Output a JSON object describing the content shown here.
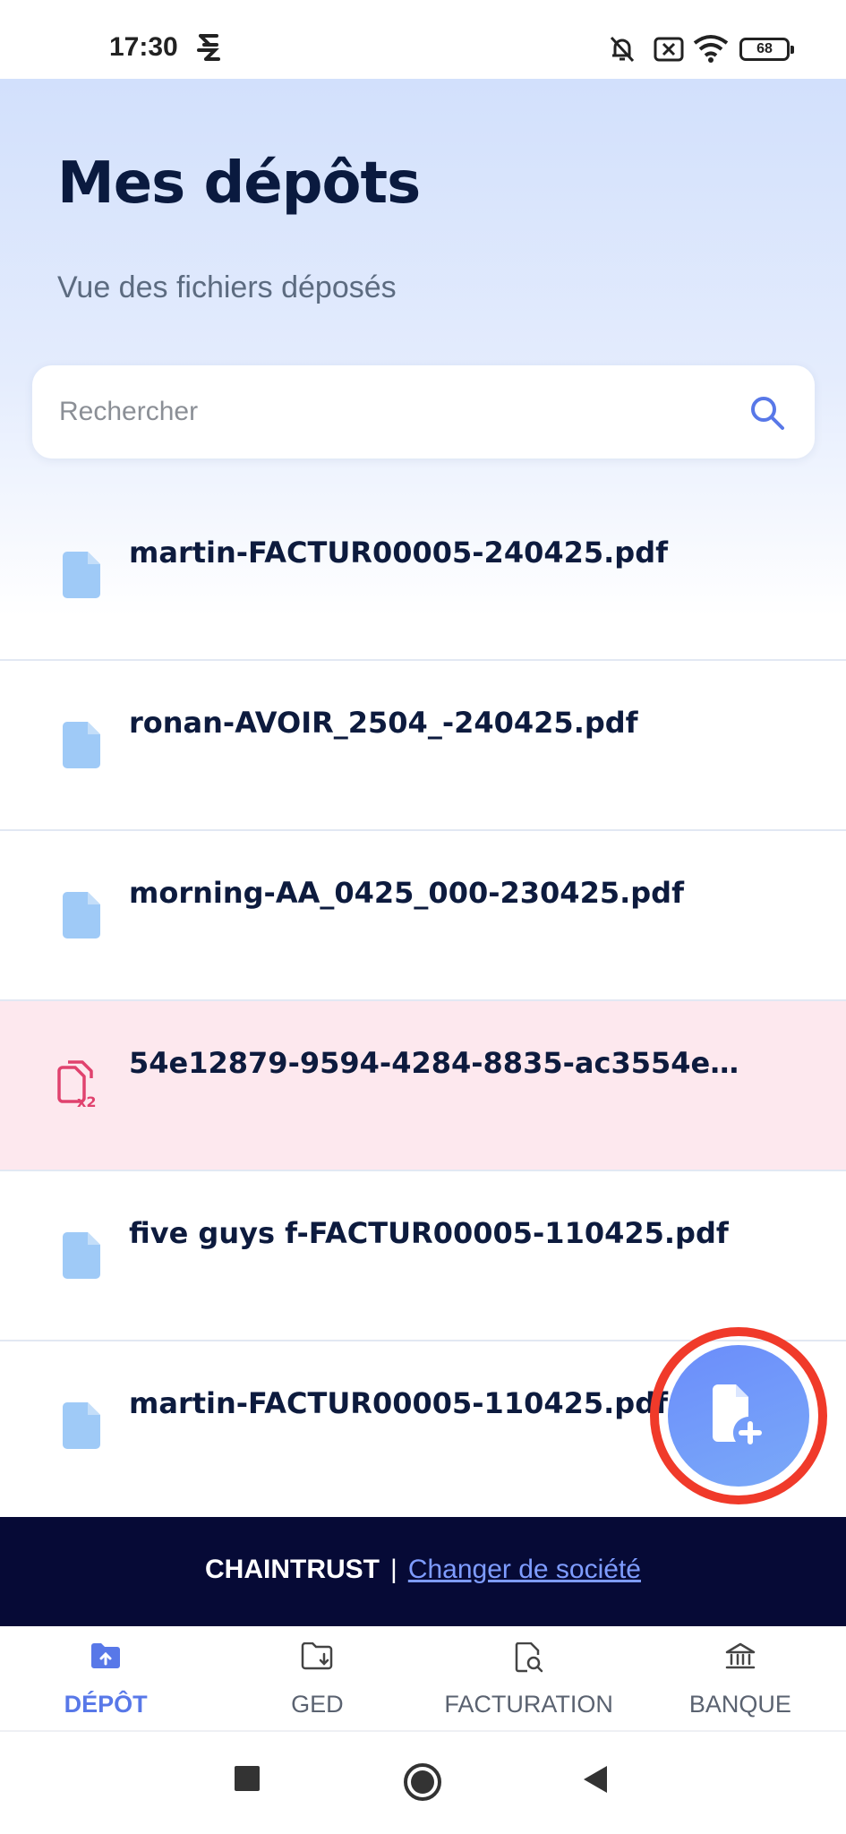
{
  "status_bar": {
    "time": "17:30",
    "battery": "68",
    "icons": [
      "signal-glyph-icon",
      "bell-muted-icon",
      "sim-x-icon",
      "wifi-icon",
      "battery-icon"
    ]
  },
  "header": {
    "title": "Mes dépôts",
    "subtitle": "Vue des fichiers déposés"
  },
  "search": {
    "placeholder": "Rechercher",
    "icon": "search-icon"
  },
  "files": [
    {
      "name": "martin-FACTUR00005-240425.pdf",
      "status": "ok",
      "icon": "file-icon"
    },
    {
      "name": "ronan-AVOIR_2504_-240425.pdf",
      "status": "ok",
      "icon": "file-icon"
    },
    {
      "name": "morning-AA_0425_000-230425.pdf",
      "status": "ok",
      "icon": "file-icon"
    },
    {
      "name": "54e12879-9594-4284-8835-ac3554e…",
      "status": "duplicate",
      "icon": "duplicate-file-icon"
    },
    {
      "name": "five guys f-FACTUR00005-110425.pdf",
      "status": "ok",
      "icon": "file-icon"
    },
    {
      "name": "martin-FACTUR00005-110425.pdf",
      "status": "ok",
      "icon": "file-icon"
    }
  ],
  "fab": {
    "icon": "add-file-icon",
    "highlight_color": "#f03a2a"
  },
  "company_bar": {
    "name": "CHAINTRUST",
    "separator": "|",
    "link": "Changer de société"
  },
  "tabs": [
    {
      "label": "DÉPÔT",
      "icon": "folder-upload-icon",
      "active": true
    },
    {
      "label": "GED",
      "icon": "folder-download-icon",
      "active": false
    },
    {
      "label": "FACTURATION",
      "icon": "invoice-search-icon",
      "active": false
    },
    {
      "label": "BANQUE",
      "icon": "bank-icon",
      "active": false
    }
  ],
  "colors": {
    "accent": "#5878e8",
    "title": "#0a1a3f",
    "error_row": "#fde8ee",
    "error_icon": "#e0426e",
    "company_bar": "#060a36"
  }
}
